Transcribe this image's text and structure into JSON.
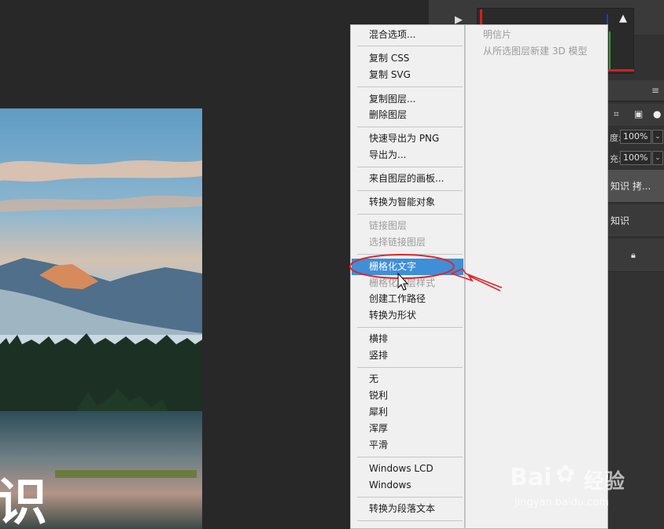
{
  "context_menu": {
    "items": [
      {
        "label": "混合选项...",
        "state": "enabled"
      },
      {
        "label": "复制 CSS",
        "state": "enabled"
      },
      {
        "label": "复制 SVG",
        "state": "enabled"
      },
      {
        "label": "复制图层...",
        "state": "enabled"
      },
      {
        "label": "删除图层",
        "state": "enabled"
      },
      {
        "label": "快速导出为 PNG",
        "state": "enabled"
      },
      {
        "label": "导出为...",
        "state": "enabled"
      },
      {
        "label": "来自图层的画板...",
        "state": "enabled"
      },
      {
        "label": "转换为智能对象",
        "state": "enabled"
      },
      {
        "label": "链接图层",
        "state": "disabled"
      },
      {
        "label": "选择链接图层",
        "state": "disabled"
      },
      {
        "label": "栅格化文字",
        "state": "highlighted"
      },
      {
        "label": "栅格化图层样式",
        "state": "disabled"
      },
      {
        "label": "创建工作路径",
        "state": "enabled"
      },
      {
        "label": "转换为形状",
        "state": "enabled"
      },
      {
        "label": "横排",
        "state": "enabled"
      },
      {
        "label": "竖排",
        "state": "enabled"
      },
      {
        "label": "无",
        "state": "enabled"
      },
      {
        "label": "锐利",
        "state": "enabled"
      },
      {
        "label": "犀利",
        "state": "enabled"
      },
      {
        "label": "浑厚",
        "state": "enabled"
      },
      {
        "label": "平滑",
        "state": "enabled"
      },
      {
        "label": "Windows LCD",
        "state": "enabled"
      },
      {
        "label": "Windows",
        "state": "enabled"
      },
      {
        "label": "转换为段落文本",
        "state": "enabled"
      }
    ]
  },
  "submenu": {
    "items": [
      "明信片",
      "从所选图层新建 3D 模型"
    ]
  },
  "right_panel": {
    "opacity_label": "度:",
    "opacity_value": "100%",
    "fill_label": "充:",
    "fill_value": "100%",
    "layers": [
      "知识 拷...",
      "知识",
      ""
    ]
  },
  "canvas": {
    "overlay_text": "识"
  },
  "watermark": {
    "brand": "Bai",
    "brand2": "经验",
    "url": "jingyan.baidu.com"
  },
  "colors": {
    "highlight": "#3f8fd8",
    "annotation": "#e0262b",
    "menu_bg": "#f0f0f0",
    "panel_bg": "#323232"
  }
}
